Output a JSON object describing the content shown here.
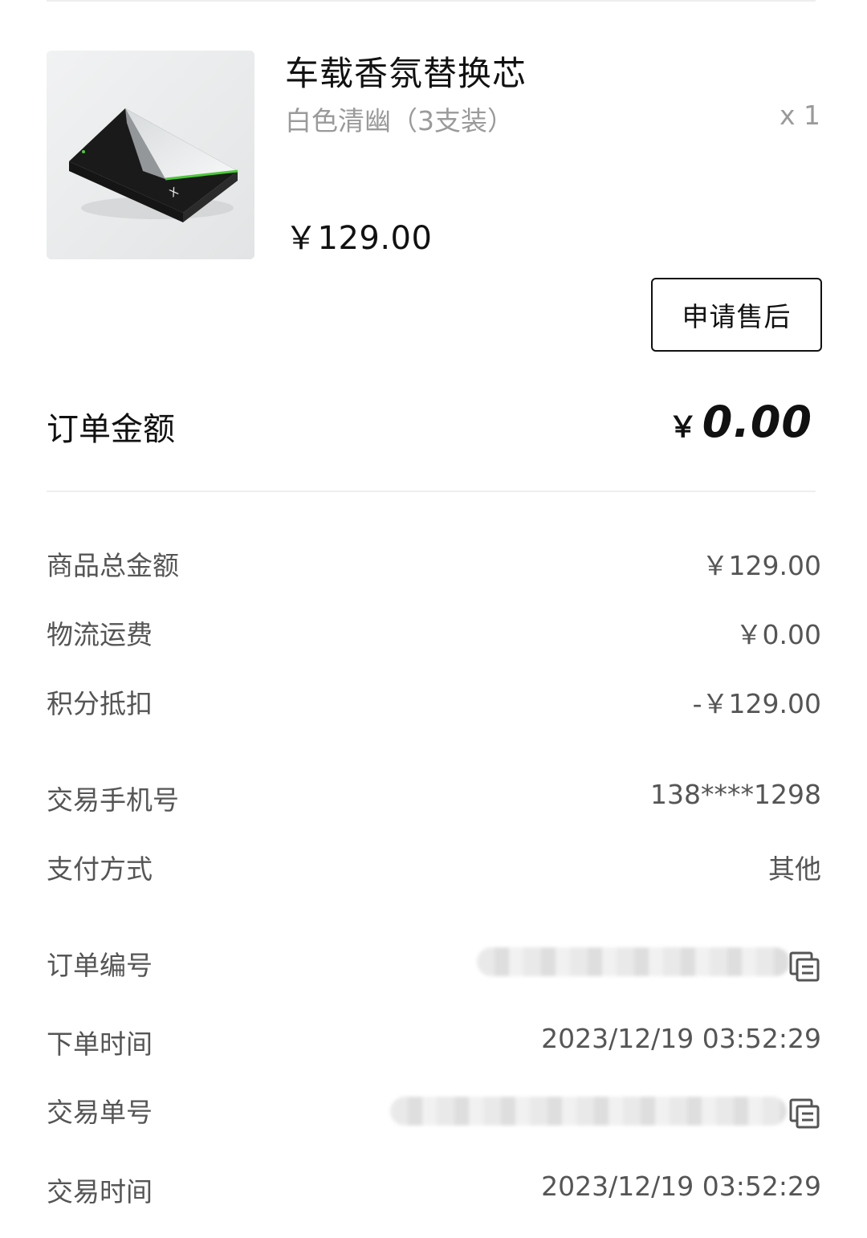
{
  "product": {
    "title": "车载香氛替换芯",
    "variant": "白色清幽（3支装）",
    "quantity": "x 1",
    "price": "￥129.00",
    "image_icon": "product-box-image"
  },
  "actions": {
    "aftersale_label": "申请售后"
  },
  "order_total": {
    "label": "订单金额",
    "currency": "￥",
    "amount": "0.00"
  },
  "breakdown": [
    {
      "label": "商品总金额",
      "value": "￥129.00"
    },
    {
      "label": "物流运费",
      "value": "￥0.00"
    },
    {
      "label": "积分抵扣",
      "value": "-￥129.00"
    }
  ],
  "transaction": [
    {
      "label": "交易手机号",
      "value": "138****1298"
    },
    {
      "label": "支付方式",
      "value": "其他"
    }
  ],
  "order_meta": {
    "order_number_label": "订单编号",
    "order_time_label": "下单时间",
    "order_time_value": "2023/12/19 03:52:29",
    "trade_number_label": "交易单号",
    "trade_time_label": "交易时间",
    "trade_time_value": "2023/12/19 03:52:29",
    "copy_icon": "copy-icon"
  },
  "colors": {
    "primary_text": "#111111",
    "secondary_text": "#555555",
    "muted_text": "#9a9a9a",
    "divider": "#eeeeee",
    "accent_green": "#4cc93a"
  }
}
